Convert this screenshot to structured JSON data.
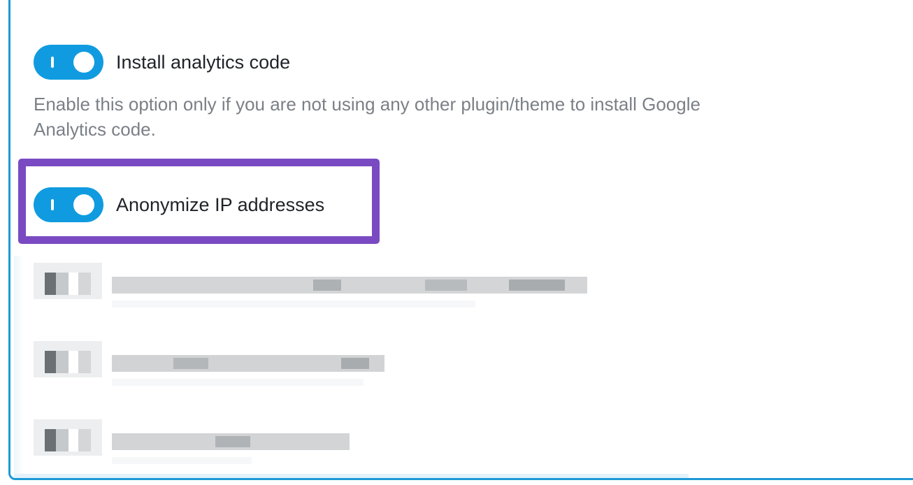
{
  "settings": {
    "install_analytics": {
      "label": "Install analytics code",
      "enabled": true,
      "description": "Enable this option only if you are not using any other plugin/theme to install Google Analytics code."
    },
    "anonymize_ip": {
      "label": "Anonymize IP addresses",
      "enabled": true,
      "highlighted": true
    }
  },
  "colors": {
    "accent": "#109be0",
    "panel_border": "#1d9ad6",
    "highlight": "#7a4ac2",
    "description_text": "#7b8087"
  },
  "blurred_options_count": 3
}
